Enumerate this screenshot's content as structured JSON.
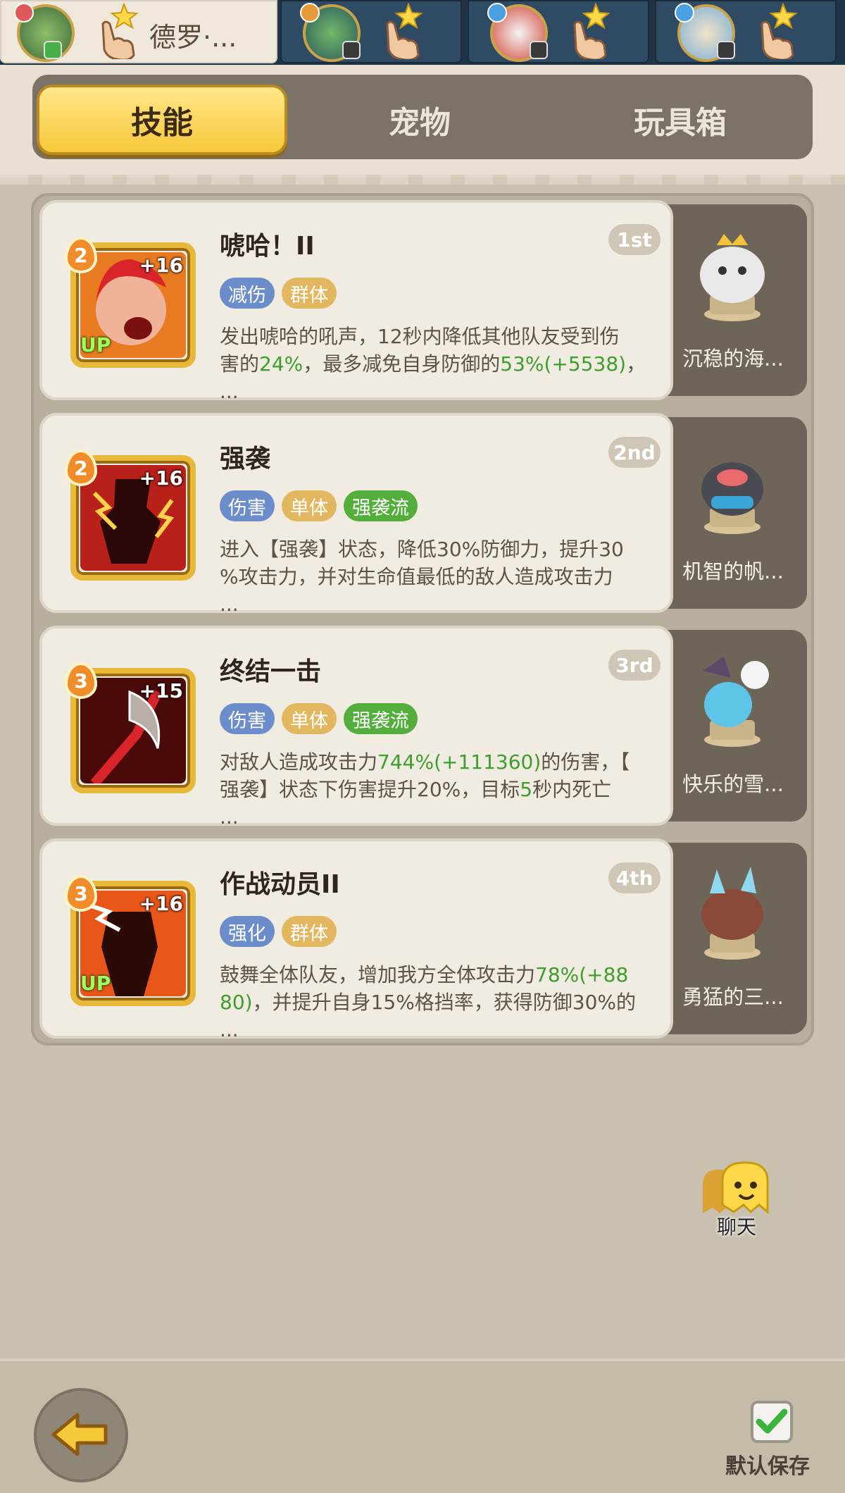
{
  "hero_tabs": [
    {
      "name": "德罗·...",
      "active": true
    },
    {
      "name": "",
      "active": false
    },
    {
      "name": "",
      "active": false
    },
    {
      "name": "",
      "active": false
    }
  ],
  "top_tabs": {
    "skills": "技能",
    "pets": "宠物",
    "toybox": "玩具箱"
  },
  "skills": [
    {
      "title": "唬哈！II",
      "rank": "1st",
      "level": "2",
      "plus": "+16",
      "up": "UP",
      "tags": [
        "减伤",
        "群体"
      ],
      "desc": {
        "l1": "发出唬哈的吼声，12秒内降低其他队友受到伤",
        "l2a": "害的",
        "l2b": "24%",
        "l2c": "，最多减免自身防御的",
        "l2d": "53%(+5538)",
        "l2e": "，",
        "l3": "..."
      },
      "pet": "沉稳的海..."
    },
    {
      "title": "强袭",
      "rank": "2nd",
      "level": "2",
      "plus": "+16",
      "up": "",
      "tags": [
        "伤害",
        "单体",
        "强袭流"
      ],
      "desc": {
        "l1": "进入【强袭】状态，降低30%防御力，提升30",
        "l2": "%攻击力，并对生命值最低的敌人造成攻击力",
        "l3": "..."
      },
      "pet": "机智的帆..."
    },
    {
      "title": "终结一击",
      "rank": "3rd",
      "level": "3",
      "plus": "+15",
      "up": "",
      "tags": [
        "伤害",
        "单体",
        "强袭流"
      ],
      "desc": {
        "l1a": "对敌人造成攻击力",
        "l1b": "744%(+111360)",
        "l1c": "的伤害，【",
        "l2a": "强袭】状态下伤害提升20%，目标",
        "l2b": "5",
        "l2c": "秒内死亡",
        "l3": "..."
      },
      "pet": "快乐的雪..."
    },
    {
      "title": "作战动员II",
      "rank": "4th",
      "level": "3",
      "plus": "+16",
      "up": "UP",
      "tags": [
        "强化",
        "群体"
      ],
      "desc": {
        "l1a": "鼓舞全体队友，增加我方全体攻击力",
        "l1b": "78%(+88",
        "l2a": "80)",
        "l2b": "，并提升自身15%格挡率，获得防御30%的",
        "l3": "..."
      },
      "pet": "勇猛的三..."
    }
  ],
  "chat_label": "聊天",
  "save_label": "默认保存",
  "colors": {
    "highlight": "#3e9e2c",
    "tab_active": "#f7c83a"
  }
}
